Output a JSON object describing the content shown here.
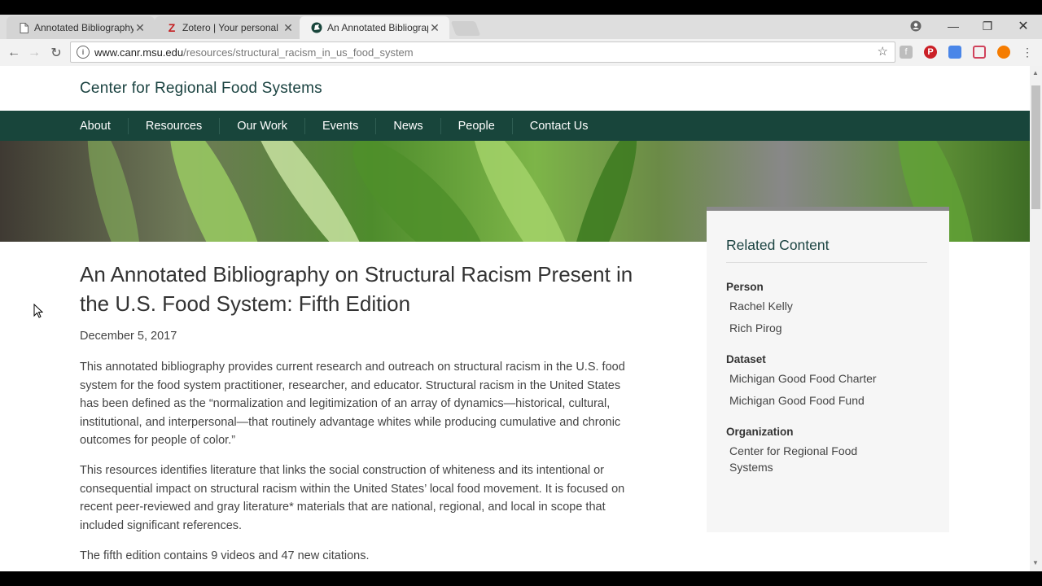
{
  "browser": {
    "tabs": [
      {
        "title": "Annotated Bibliography",
        "favicon": "document-icon",
        "active": false
      },
      {
        "title": "Zotero | Your personal re",
        "favicon": "zotero-icon",
        "active": false
      },
      {
        "title": "An Annotated Bibliograp",
        "favicon": "msu-spartan-icon",
        "active": true
      }
    ],
    "url_host": "www.canr.msu.edu",
    "url_path": "/resources/structural_racism_in_us_food_system",
    "colors": {
      "zotero_red": "#c41e20",
      "pinterest_red": "#cb2027"
    }
  },
  "site": {
    "title": "Center for Regional Food Systems",
    "nav": [
      "About",
      "Resources",
      "Our Work",
      "Events",
      "News",
      "People",
      "Contact Us"
    ],
    "colors": {
      "nav_bg": "#18453b",
      "title_color": "#1b4341"
    }
  },
  "article": {
    "title": "An Annotated Bibliography on Structural Racism Present in the U.S. Food System: Fifth Edition",
    "date": "December 5, 2017",
    "paragraphs": [
      "This annotated bibliography provides current research and outreach on structural racism in the U.S. food system for the food system practitioner, researcher, and educator. Structural racism in the United States has been defined as the “normalization and legitimization of an array of dynamics—historical, cultural, institutional, and interpersonal—that routinely advantage whites while producing cumulative and chronic outcomes for people of color.”",
      "This resources identifies literature that links the social construction of whiteness and its intentional or consequential impact on structural racism within the United States’ local food movement. It is focused on recent peer-reviewed and gray literature* materials that are national, regional, and local in scope that included significant references.",
      "The fifth edition contains 9 videos and 47 new citations."
    ]
  },
  "related": {
    "title": "Related Content",
    "person_label": "Person",
    "persons": [
      "Rachel Kelly",
      "Rich Pirog"
    ],
    "dataset_label": "Dataset",
    "datasets": [
      "Michigan Good Food Charter",
      "Michigan Good Food Fund"
    ],
    "organization_label": "Organization",
    "organizations": [
      "Center for Regional Food Systems"
    ]
  }
}
